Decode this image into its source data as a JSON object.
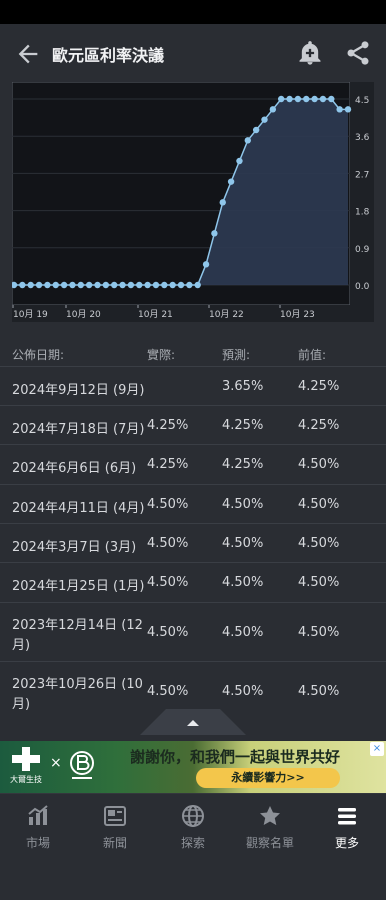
{
  "header": {
    "title": "歐元區利率決議"
  },
  "chart_data": {
    "type": "area",
    "x_tick_labels": [
      "10月 19",
      "10月 20",
      "10月 21",
      "10月 22",
      "10月 23"
    ],
    "y_tick_labels": [
      "4.5",
      "3.6",
      "2.7",
      "1.8",
      "0.9",
      "0.0"
    ],
    "ylim": [
      0,
      4.5
    ],
    "series": [
      {
        "values": [
          0.0,
          0.0,
          0.0,
          0.0,
          0.0,
          0.0,
          0.0,
          0.0,
          0.0,
          0.0,
          0.0,
          0.0,
          0.0,
          0.0,
          0.0,
          0.0,
          0.0,
          0.0,
          0.0,
          0.0,
          0.0,
          0.0,
          0.0,
          0.5,
          1.25,
          2.0,
          2.5,
          3.0,
          3.5,
          3.75,
          4.0,
          4.25,
          4.5,
          4.5,
          4.5,
          4.5,
          4.5,
          4.5,
          4.5,
          4.25,
          4.25
        ]
      }
    ],
    "colors": {
      "line": "#8fc6ea",
      "fill": "#2e3a52",
      "bg": "#121418"
    }
  },
  "table": {
    "headers": {
      "date": "公佈日期:",
      "actual": "實際:",
      "forecast": "預測:",
      "previous": "前值:"
    },
    "rows": [
      {
        "date": "2024年9月12日 (9月)",
        "actual": "",
        "forecast": "3.65%",
        "previous": "4.25%"
      },
      {
        "date": "2024年7月18日 (7月)",
        "actual": "4.25%",
        "forecast": "4.25%",
        "previous": "4.25%"
      },
      {
        "date": "2024年6月6日 (6月)",
        "actual": "4.25%",
        "forecast": "4.25%",
        "previous": "4.50%"
      },
      {
        "date": "2024年4月11日 (4月)",
        "actual": "4.50%",
        "forecast": "4.50%",
        "previous": "4.50%"
      },
      {
        "date": "2024年3月7日 (3月)",
        "actual": "4.50%",
        "forecast": "4.50%",
        "previous": "4.50%"
      },
      {
        "date": "2024年1月25日 (1月)",
        "actual": "4.50%",
        "forecast": "4.50%",
        "previous": "4.50%"
      },
      {
        "date_line1": "2023年12月14日 (12",
        "date_line2": "月)",
        "actual": "4.50%",
        "forecast": "4.50%",
        "previous": "4.50%"
      },
      {
        "date_line1": "2023年10月26日 (10",
        "date_line2": "月)",
        "actual": "4.50%",
        "forecast": "4.50%",
        "previous": "4.50%"
      }
    ]
  },
  "ad": {
    "brand": "大爾生技",
    "headline": "謝謝你，和我們一起與世界共好",
    "button": "永續影響力>>",
    "close": "×"
  },
  "nav": {
    "items": [
      {
        "label": "市場",
        "icon": "market-chart-icon"
      },
      {
        "label": "新聞",
        "icon": "news-icon"
      },
      {
        "label": "探索",
        "icon": "globe-icon"
      },
      {
        "label": "觀察名單",
        "icon": "star-icon"
      },
      {
        "label": "更多",
        "icon": "menu-icon"
      }
    ],
    "active_index": 4
  }
}
